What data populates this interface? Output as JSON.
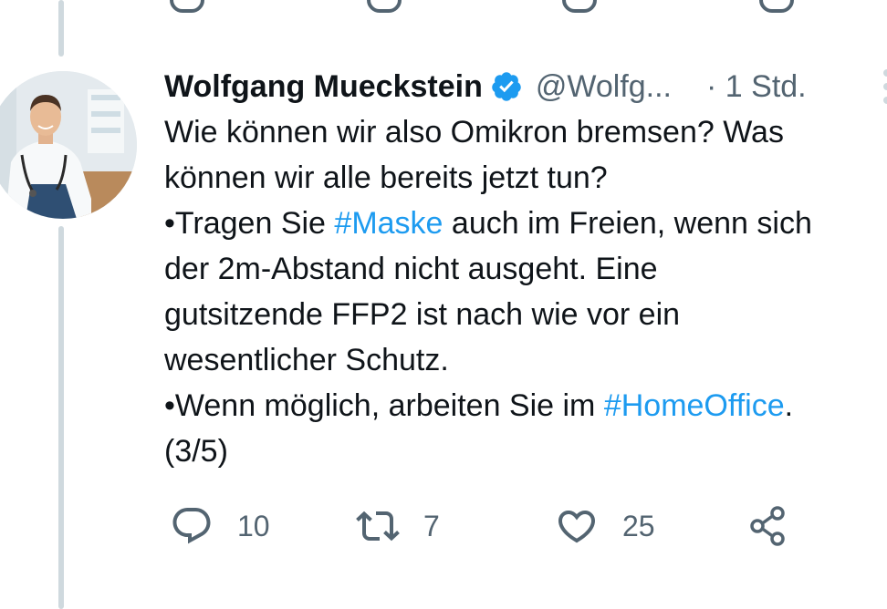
{
  "tweet": {
    "display_name": "Wolfgang Mueckstein",
    "handle": "@Wolfg...",
    "time": "· 1 Std.",
    "lines": [
      [
        {
          "t": "Wie können wir also Omikron bremsen? Was"
        }
      ],
      [
        {
          "t": "können wir alle bereits jetzt tun?"
        }
      ],
      [
        {
          "t": "•Tragen Sie "
        },
        {
          "t": "#Maske",
          "tag": true
        },
        {
          "t": " auch im Freien, wenn sich"
        }
      ],
      [
        {
          "t": "der 2m-Abstand nicht ausgeht. Eine"
        }
      ],
      [
        {
          "t": "gutsitzende FFP2 ist nach wie vor ein"
        }
      ],
      [
        {
          "t": "wesentlicher Schutz."
        }
      ],
      [
        {
          "t": "•Wenn möglich, arbeiten Sie im "
        },
        {
          "t": "#HomeOffice",
          "tag": true
        },
        {
          "t": "."
        }
      ],
      [
        {
          "t": "(3/5)"
        }
      ]
    ]
  },
  "actions": {
    "replies": "10",
    "retweets": "7",
    "likes": "25"
  },
  "colors": {
    "text": "#0f1419",
    "secondary": "#536471",
    "hashtag": "#1d9bf0",
    "verified": "#1d9bf0",
    "thread_line": "#cfd9de"
  },
  "icons": {
    "reply": "reply-icon",
    "retweet": "retweet-icon",
    "like": "heart-icon",
    "share": "share-icon",
    "verified": "verified-badge-icon",
    "more": "more-icon"
  }
}
